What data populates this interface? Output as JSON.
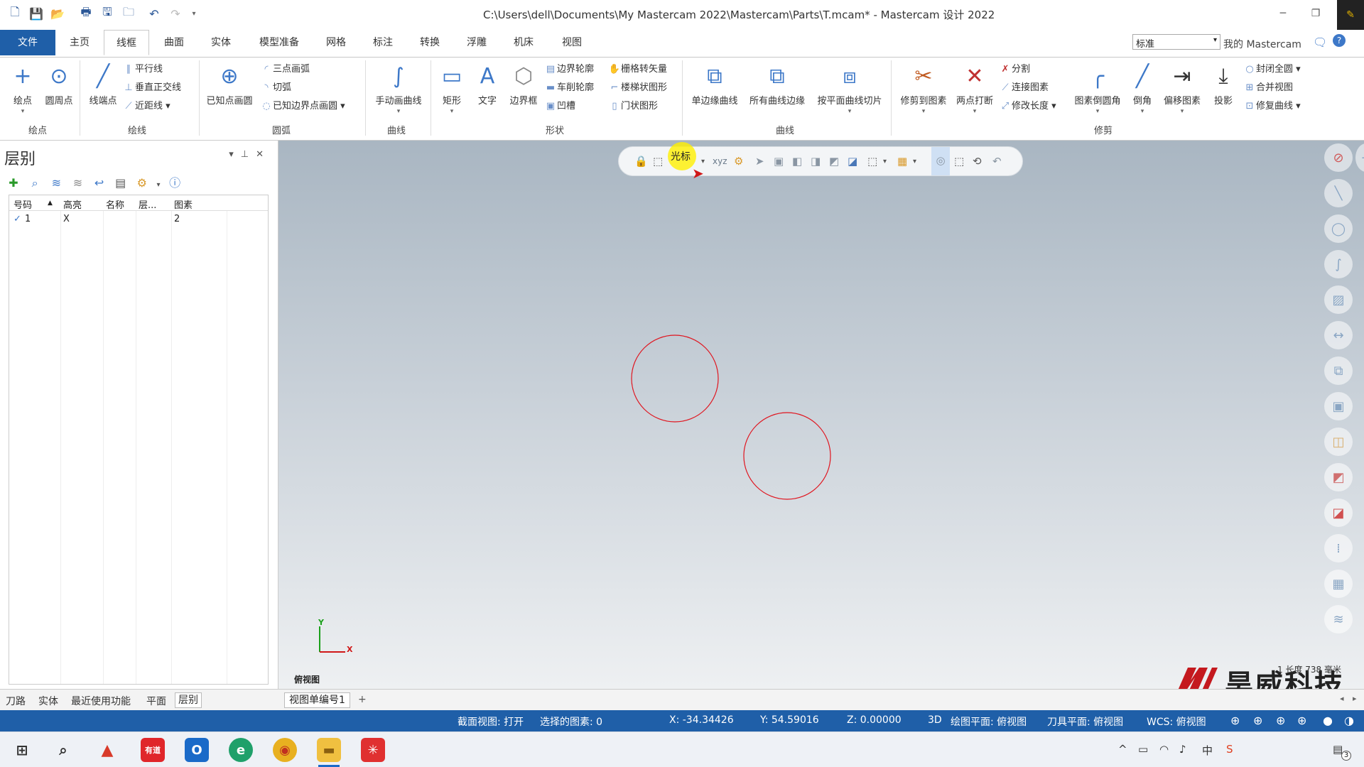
{
  "titlebar": {
    "title": "C:\\Users\\dell\\Documents\\My Mastercam 2022\\Mastercam\\Parts\\T.mcam* - Mastercam 设计 2022"
  },
  "tabs": {
    "file": "文件",
    "items": [
      "主页",
      "线框",
      "曲面",
      "实体",
      "模型准备",
      "网格",
      "标注",
      "转换",
      "浮雕",
      "机床",
      "视图"
    ],
    "active": "线框",
    "config_select": "标准",
    "my_mastercam": "我的 Mastercam"
  },
  "ribbon": {
    "groups": {
      "points": "绘点",
      "lines": "绘线",
      "arcs": "圆弧",
      "splines": "曲线",
      "shapes": "形状",
      "curves": "曲线",
      "modify": "修剪"
    },
    "points": {
      "point": "绘点",
      "bolt_circle": "圆周点"
    },
    "lines": {
      "endpoints": "线端点",
      "parallel": "平行线",
      "perpendicular": "垂直正交线",
      "closest": "近距线"
    },
    "arcs": {
      "circle_center": "已知点画圆",
      "three_point": "三点画弧",
      "tangent": "切弧",
      "edge_points": "已知边界点画圆"
    },
    "splines": {
      "manual": "手动画曲线"
    },
    "shapes": {
      "rectangle": "矩形",
      "text": "文字",
      "bounding_box": "边界框",
      "boundary": "边界轮廓",
      "turn_profile": "车削轮廓",
      "groove": "凹槽",
      "grid_vector": "栅格转矢量",
      "stair": "楼梯状图形",
      "door": "门状图形"
    },
    "curves": {
      "single_edge": "单边缘曲线",
      "all_edges": "所有曲线边缘",
      "slice": "按平面曲线切片"
    },
    "modify": {
      "trim_to": "修剪到图素",
      "two_point_break": "两点打断",
      "divide": "分割",
      "join": "连接图素",
      "modify_length": "修改长度",
      "fillet": "图素倒圆角",
      "chamfer": "倒角",
      "offset": "偏移图素",
      "project": "投影",
      "close_arc": "封闭全圆",
      "merge_views": "合并视图",
      "repair_curve": "修复曲线"
    }
  },
  "panel": {
    "title": "层别",
    "columns": [
      "号码",
      "高亮",
      "名称",
      "层...",
      "图素"
    ],
    "rows": [
      {
        "check": "✓",
        "number": "1",
        "highlight": "X",
        "name": "",
        "set": "",
        "entities": "2"
      }
    ],
    "tabs": [
      "刀路",
      "实体",
      "最近使用功能",
      "平面",
      "层别"
    ],
    "active_tab": "层别"
  },
  "viewport": {
    "selection_mode": "光标",
    "view_label": "俯视图",
    "axis_y": "Y",
    "axis_x": "X",
    "watermark_text": "昊威科技",
    "watermark_small": "1 长度 738 毫米"
  },
  "sheets": {
    "tab": "视图单编号1",
    "add": "+"
  },
  "status": {
    "section_view": "截面视图: 打开",
    "selected": "选择的图素: 0",
    "x": "X:  -34.34426",
    "y": "Y:  54.59016",
    "z": "Z:  0.00000",
    "mode": "3D",
    "cplane": "绘图平面: 俯视图",
    "tplane": "刀具平面: 俯视图",
    "wcs": "WCS: 俯视图"
  },
  "taskbar": {
    "youdao": "有道",
    "ime": "中",
    "notifications": "3"
  },
  "colors": {
    "accent": "#1f5fa8",
    "geometry": "#e0141e"
  }
}
